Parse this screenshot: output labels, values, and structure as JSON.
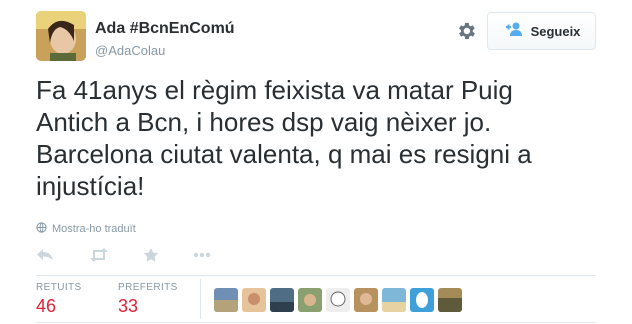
{
  "user": {
    "name": "Ada #BcnEnComú",
    "handle": "@AdaColau",
    "follow_label": "Segueix"
  },
  "tweet": {
    "lines": [
      "Fa 41anys el règim feixista va matar Puig",
      "Antich a Bcn, i hores dsp vaig nèixer jo.",
      "Barcelona ciutat valenta, q mai es resigni a",
      "injustícia!"
    ],
    "translate_label": "Mostra-ho traduït"
  },
  "actions": {
    "icons": [
      "reply-icon",
      "retweet-icon",
      "favorite-icon",
      "more-icon"
    ]
  },
  "stats": {
    "retweets_label": "RETUITS",
    "retweets": "46",
    "favorites_label": "PREFERITS",
    "favorites": "33"
  },
  "colors": {
    "text": "#292f33",
    "muted": "#8899a6",
    "accent_blue": "#55acee",
    "stat_red": "#e1233a"
  }
}
